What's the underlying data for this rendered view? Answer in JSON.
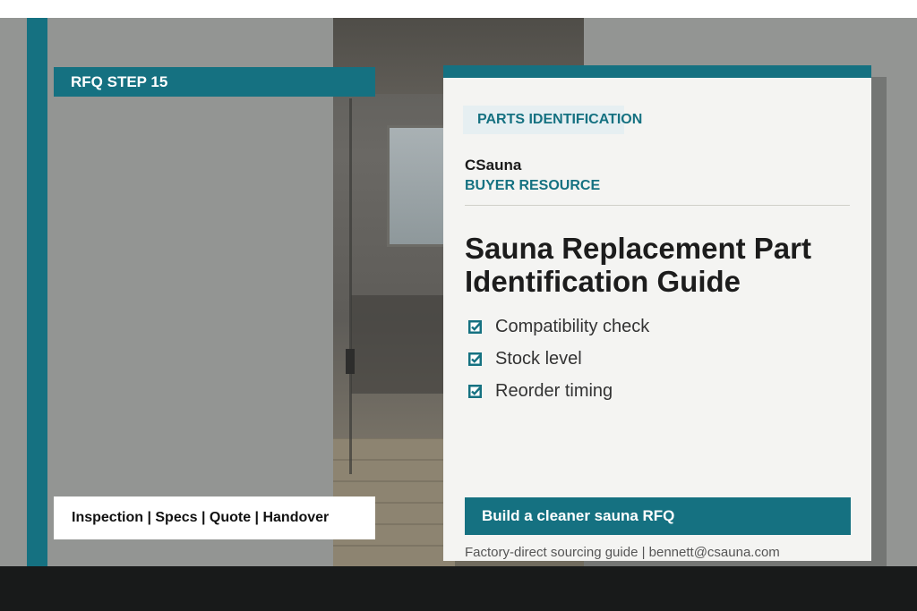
{
  "step_tag": "RFQ STEP 15",
  "tagline": "Inspection | Specs | Quote | Handover",
  "card": {
    "section_badge": "PARTS IDENTIFICATION",
    "brand": "CSauna",
    "brand_sub": "BUYER RESOURCE",
    "title": "Sauna Replacement Part Identification Guide",
    "features": [
      {
        "label": "Compatibility check",
        "icon": "checkbox-icon"
      },
      {
        "label": "Stock level",
        "icon": "checkbox-icon"
      },
      {
        "label": "Reorder timing",
        "icon": "checkbox-icon"
      }
    ],
    "cta_label": "Build a cleaner sauna RFQ",
    "footer": "Factory-direct sourcing guide | bennett@csauna.com"
  },
  "colors": {
    "accent": "#157181",
    "background": "#939593",
    "card": "#f4f4f2",
    "bottom_band": "#181a1a"
  }
}
